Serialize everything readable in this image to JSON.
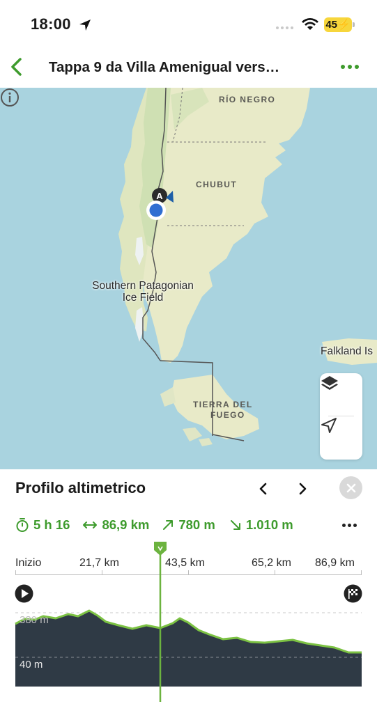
{
  "status_bar": {
    "time": "18:00",
    "battery": "45"
  },
  "nav": {
    "title": "Tappa 9 da Villa Amenigual vers…"
  },
  "map": {
    "labels": {
      "rio_negro": "RÍO NEGRO",
      "chubut": "CHUBUT",
      "ice_field_line1": "Southern Patagonian",
      "ice_field_line2": "Ice Field",
      "tierra_line1": "TIERRA DEL",
      "tierra_line2": "FUEGO",
      "falkland": "Falkland Is"
    },
    "marker_letter": "A"
  },
  "panel": {
    "title": "Profilo altimetrico",
    "stats": {
      "duration": "5 h 16",
      "distance": "86,9 km",
      "ascent": "780 m",
      "descent": "1.010 m"
    },
    "axis": [
      "Inizio",
      "21,7 km",
      "43,5 km",
      "65,2 km",
      "86,9 km"
    ],
    "elevation_labels": {
      "top": "380 m",
      "bottom": "40 m"
    },
    "cursor_fraction": 0.42
  },
  "colors": {
    "accent": "#3e9b2d",
    "profile_fill": "#2f3a45",
    "water": "#a9d3df",
    "land": "#e8eac8"
  }
}
